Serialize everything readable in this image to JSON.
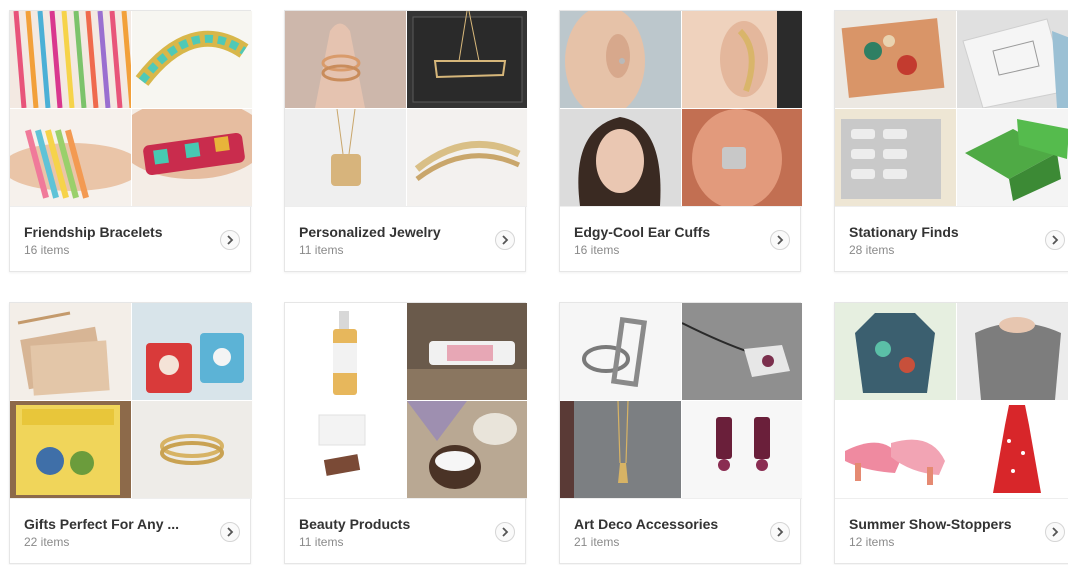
{
  "collections": [
    {
      "title": "Friendship Bracelets",
      "count": "16 items",
      "thumbs": [
        "friendship-bracelets-photo",
        "chevron-bracelet-photo",
        "wrist-bracelets-photo",
        "beaded-cuff-photo"
      ]
    },
    {
      "title": "Personalized Jewelry",
      "count": "11 items",
      "thumbs": [
        "initial-rings-photo",
        "state-necklace-photo",
        "stamped-pendant-photo",
        "gold-cuffs-photo"
      ]
    },
    {
      "title": "Edgy-Cool Ear Cuffs",
      "count": "16 items",
      "thumbs": [
        "ear-cuff-side-photo",
        "ear-climber-photo",
        "model-portrait-photo",
        "silver-ear-cuff-photo"
      ]
    },
    {
      "title": "Stationary Finds",
      "count": "28 items",
      "thumbs": [
        "floral-notebook-photo",
        "envelopes-photo",
        "patterned-card-photo",
        "green-tin-box-photo"
      ]
    },
    {
      "title": "Gifts Perfect For Any ...",
      "count": "22 items",
      "thumbs": [
        "kraft-envelopes-photo",
        "printed-mugs-photo",
        "wizard-of-oz-book-photo",
        "gold-rings-photo"
      ]
    },
    {
      "title": "Beauty Products",
      "count": "11 items",
      "thumbs": [
        "spray-bottle-photo",
        "perfume-oil-photo",
        "soap-bars-photo",
        "lotion-tins-photo"
      ]
    },
    {
      "title": "Art Deco Accessories",
      "count": "21 items",
      "thumbs": [
        "deco-ring-photo",
        "deco-pendant-photo",
        "deco-necklace-photo",
        "deco-earrings-photo"
      ]
    },
    {
      "title": "Summer Show-Stoppers",
      "count": "12 items",
      "thumbs": [
        "floral-top-photo",
        "grey-sweater-photo",
        "pink-shoes-photo",
        "red-dress-photo"
      ]
    }
  ],
  "colors": {
    "title": "#333333",
    "count": "#8a8a8a",
    "card_border": "#e6e6e6"
  }
}
